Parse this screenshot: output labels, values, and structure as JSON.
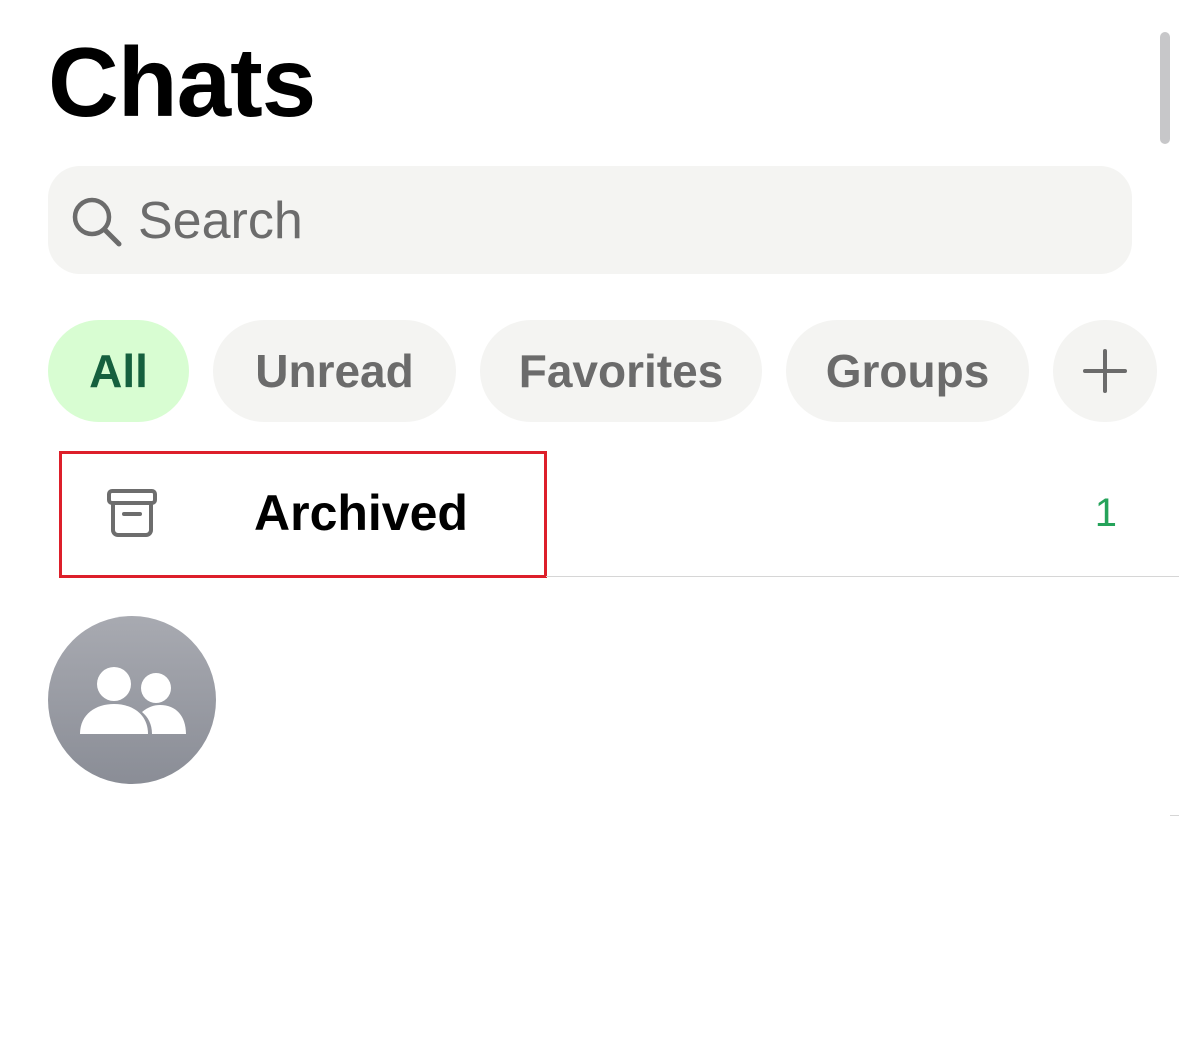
{
  "header": {
    "title": "Chats"
  },
  "search": {
    "placeholder": "Search"
  },
  "filters": {
    "chips": [
      {
        "label": "All",
        "active": true
      },
      {
        "label": "Unread",
        "active": false
      },
      {
        "label": "Favorites",
        "active": false
      },
      {
        "label": "Groups",
        "active": false
      }
    ],
    "add_icon": "plus-icon"
  },
  "archived": {
    "label": "Archived",
    "count": "1",
    "icon": "archive-box-icon"
  },
  "chat_list": {
    "items": [
      {
        "avatar_icon": "group-avatar-icon"
      }
    ]
  },
  "colors": {
    "accent_green": "#25a35a",
    "active_chip_bg": "#d8fdd2",
    "active_chip_text": "#15603e",
    "highlight_red": "#dd1f2a"
  }
}
